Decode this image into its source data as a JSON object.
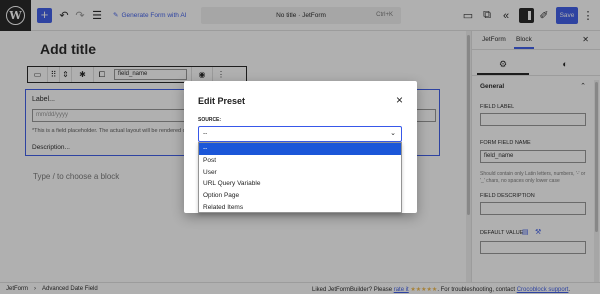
{
  "topbar": {
    "add_label": "+",
    "undo_icon": "↶",
    "redo_icon": "↷",
    "list_icon": "☰",
    "generate_ai": "Generate Form with AI",
    "doc_title": "No title · JetForm",
    "shortcut": "Ctrl+K",
    "save_label": "Save",
    "more_icon": "⋮"
  },
  "canvas": {
    "title_placeholder": "Add title",
    "toolbar_field": "field_name",
    "block_label": "Label...",
    "input_placeholder": "mm/dd/yyyy",
    "note": "*This is a field placeholder. The actual layout will be rendered on the front-end.",
    "description": "Description...",
    "choose_block": "Type / to choose a block"
  },
  "sidebar": {
    "tab_form": "JetForm",
    "tab_block": "Block",
    "section": "General",
    "field_label_lbl": "FIELD LABEL",
    "field_name_lbl": "FORM FIELD NAME",
    "field_name_value": "field_name",
    "help": "Should contain only Latin letters, numbers, '-' or '_' chars, no spaces only lower case",
    "desc_lbl": "FIELD DESCRIPTION",
    "default_lbl": "DEFAULT VALUE"
  },
  "modal": {
    "title": "Edit Preset",
    "close": "×",
    "source_label": "SOURCE:",
    "selected": "--",
    "options": [
      "--",
      "Post",
      "User",
      "URL Query Variable",
      "Option Page",
      "Related Items"
    ]
  },
  "footer": {
    "crumb1": "JetForm",
    "crumb2": "Advanced Date Field",
    "msg_pre": "Liked JetFormBuilder? Please",
    "rate": "rate it",
    "stars": "★★★★★",
    "msg_post": ". For troubleshooting, contact",
    "support": "Crocoblock support",
    "dot": "."
  }
}
